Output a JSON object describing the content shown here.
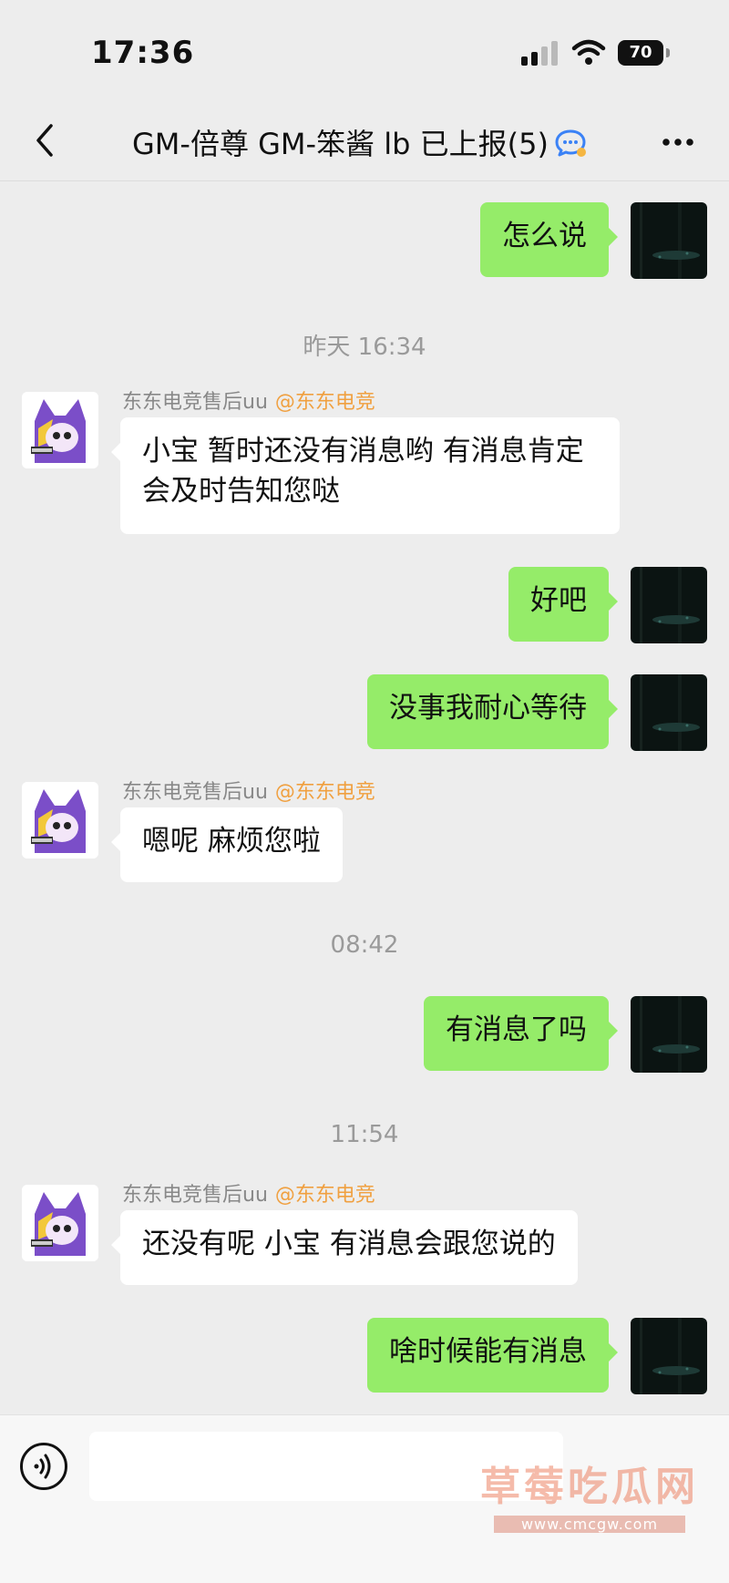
{
  "status_bar": {
    "time": "17:36",
    "battery": "70"
  },
  "header": {
    "title": "GM-倍尊 GM-笨酱 lb 已上报(5)"
  },
  "messages": {
    "m1": {
      "text": "怎么说"
    },
    "ts1": "昨天 16:34",
    "m2": {
      "sender": "东东电竞售后uu",
      "tag": "@东东电竞",
      "text": "小宝 暂时还没有消息哟 有消息肯定会及时告知您哒"
    },
    "m3": {
      "text": "好吧"
    },
    "m4": {
      "text": "没事我耐心等待"
    },
    "m5": {
      "sender": "东东电竞售后uu",
      "tag": "@东东电竞",
      "text": "嗯呢 麻烦您啦"
    },
    "ts2": "08:42",
    "m6": {
      "text": "有消息了吗"
    },
    "ts3": "11:54",
    "m7": {
      "sender": "东东电竞售后uu",
      "tag": "@东东电竞",
      "text": "还没有呢 小宝 有消息会跟您说的"
    },
    "m8": {
      "text": "啥时候能有消息"
    }
  },
  "input": {
    "value": "",
    "placeholder": ""
  },
  "watermark": {
    "text": "草莓吃瓜网",
    "url": "www.cmcgw.com"
  },
  "colors": {
    "outgoing_bubble": "#95ec69",
    "incoming_bubble": "#ffffff",
    "background": "#ededed",
    "tag_orange": "#f0a040",
    "chat_icon_blue": "#3b82f6"
  },
  "icons": [
    "back-chevron-icon",
    "chat-bubble-icon",
    "more-icon",
    "voice-icon",
    "signal-icon",
    "wifi-icon",
    "battery-icon"
  ]
}
